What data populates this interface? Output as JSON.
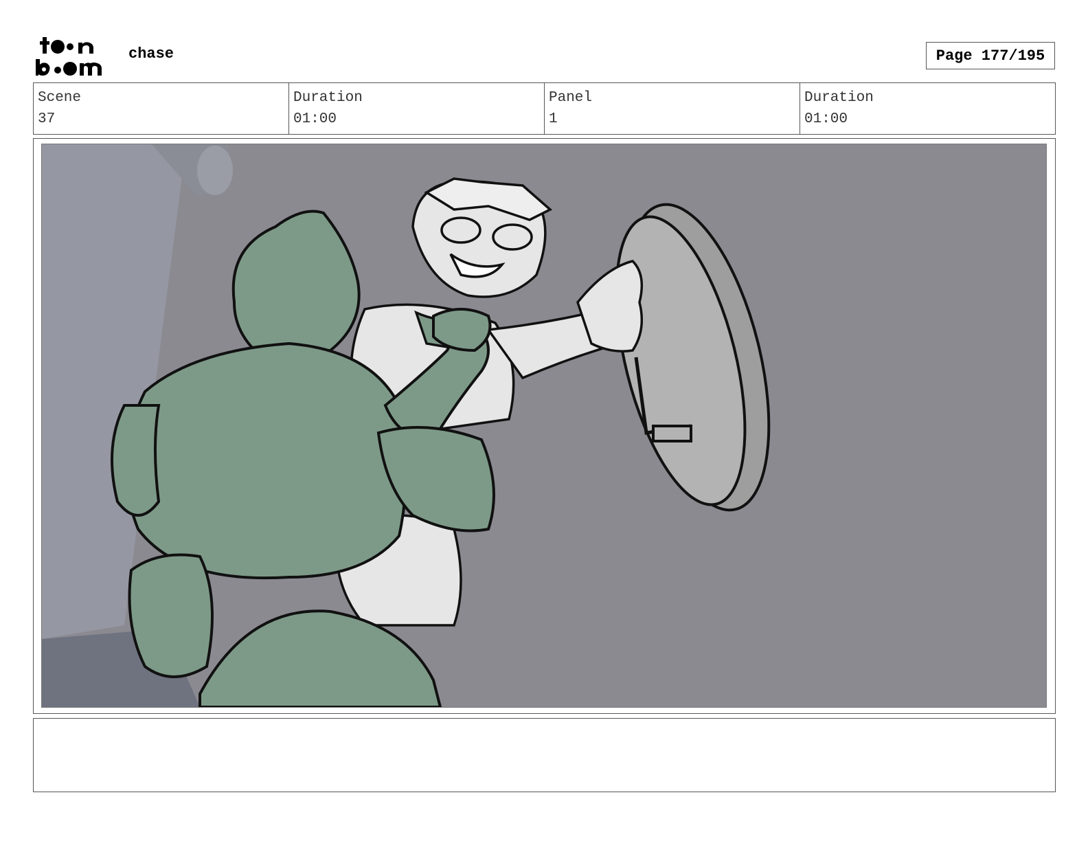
{
  "header": {
    "project_title": "chase",
    "page_label": "Page 177/195",
    "logo_text": "toon boom"
  },
  "info": {
    "scene_label": "Scene",
    "scene_value": "37",
    "duration_label": "Duration",
    "duration_value": "01:00",
    "panel_label": "Panel",
    "panel_value": "1",
    "panel_duration_label": "Duration",
    "panel_duration_value": "01:00"
  },
  "panel": {
    "illustration": "frog-creature-grabbing-boy-reaching-for-clock"
  },
  "notes": {
    "text": ""
  },
  "colors": {
    "background": "#8b8a91",
    "frog_green": "#7d9a88",
    "boy_white": "#e6e6e6",
    "clock_gray": "#b3b3b3",
    "ink": "#111111"
  }
}
